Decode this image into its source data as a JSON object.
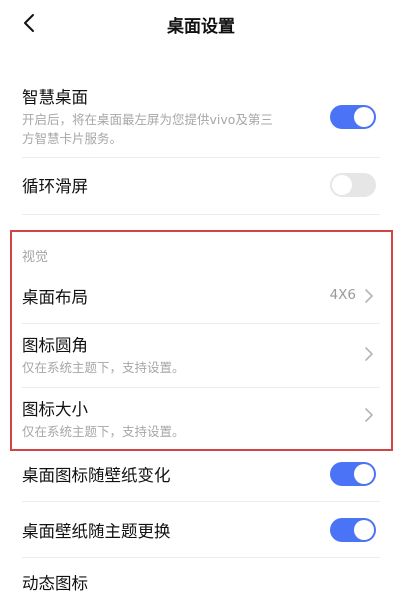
{
  "header": {
    "title": "桌面设置"
  },
  "smart_desktop": {
    "title": "智慧桌面",
    "desc_line1": "开启后，将在桌面最左屏为您提供vivo及第三",
    "desc_line2": "方智慧卡片服务。",
    "enabled": true
  },
  "loop_scroll": {
    "title": "循环滑屏",
    "enabled": false
  },
  "visual_section": {
    "label": "视觉"
  },
  "layout": {
    "title": "桌面布局",
    "value": "4X6"
  },
  "icon_corner": {
    "title": "图标圆角",
    "desc": "仅在系统主题下，支持设置。"
  },
  "icon_size": {
    "title": "图标大小",
    "desc": "仅在系统主题下，支持设置。"
  },
  "icon_follow_wallpaper": {
    "title": "桌面图标随壁纸变化",
    "enabled": true
  },
  "wallpaper_follow_theme": {
    "title": "桌面壁纸随主题更换",
    "enabled": true
  },
  "dynamic_icon": {
    "title": "动态图标"
  },
  "colors": {
    "accent": "#4a73f5",
    "highlight_border": "#d34545"
  }
}
